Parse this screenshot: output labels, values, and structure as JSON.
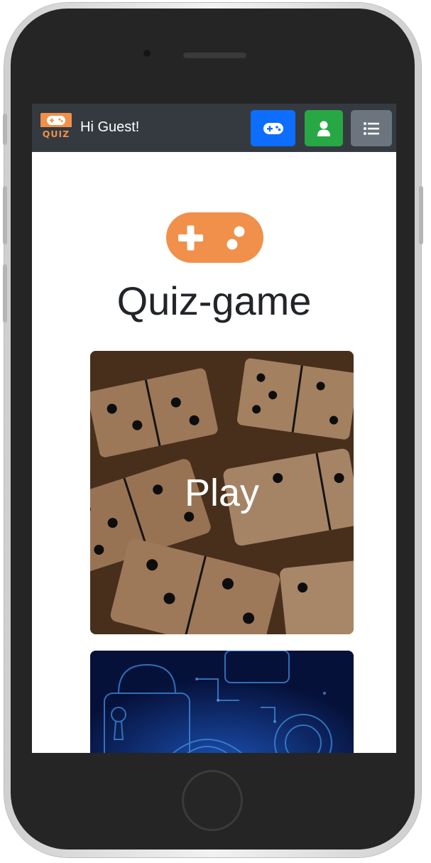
{
  "app": {
    "logo_text": "QUIZ",
    "greeting": "Hi Guest!",
    "title": "Quiz-game"
  },
  "navbar": {
    "buttons": [
      {
        "name": "game",
        "icon": "gamepad-icon",
        "color": "#0d6efd"
      },
      {
        "name": "profile",
        "icon": "user-icon",
        "color": "#28a745"
      },
      {
        "name": "menu",
        "icon": "list-icon",
        "color": "#6c757d"
      }
    ],
    "background": "#343a40"
  },
  "colors": {
    "accent": "#f0904a",
    "text": "#212529"
  },
  "cards": [
    {
      "label": "Play",
      "image": "dominoes"
    },
    {
      "label": "",
      "image": "circuit-padlocks"
    }
  ]
}
